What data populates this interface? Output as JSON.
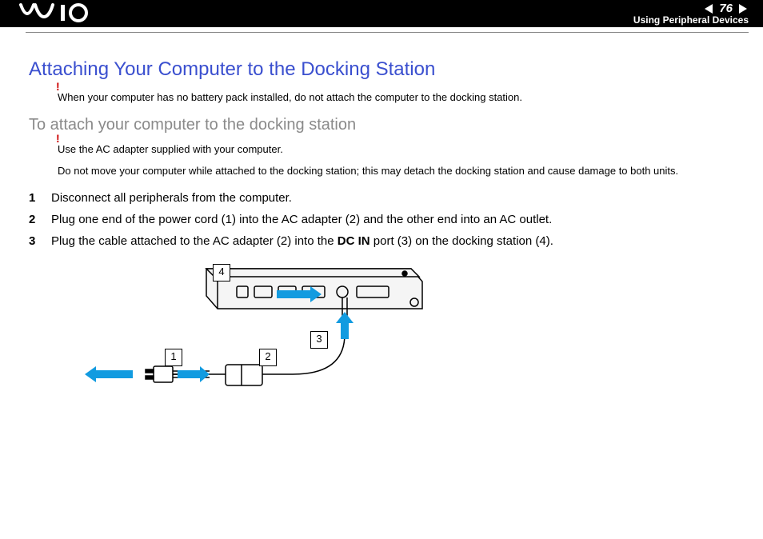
{
  "header": {
    "logo_text": "VAIO",
    "page_number": "76",
    "breadcrumb": "Using Peripheral Devices"
  },
  "title": "Attaching Your Computer to the Docking Station",
  "note_top": "When your computer has no battery pack installed, do not attach the computer to the docking station.",
  "subtitle": "To attach your computer to the docking station",
  "note_ac": "Use the AC adapter supplied with your computer.",
  "note_move": "Do not move your computer while attached to the docking station; this may detach the docking station and cause damage to both units.",
  "steps": [
    {
      "num": "1",
      "text": "Disconnect all peripherals from the computer."
    },
    {
      "num": "2",
      "text": "Plug one end of the power cord (1) into the AC adapter (2) and the other end into an AC outlet."
    },
    {
      "num": "3",
      "text_pre": "Plug the cable attached to the AC adapter (2) into the ",
      "bold": "DC IN",
      "text_post": " port (3) on the docking station (4)."
    }
  ],
  "figure": {
    "callouts": {
      "c1": "1",
      "c2": "2",
      "c3": "3",
      "c4": "4"
    }
  }
}
